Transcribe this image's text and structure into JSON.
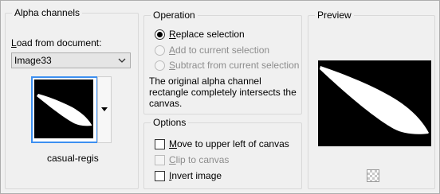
{
  "alpha_channels": {
    "title": "Alpha channels",
    "load_from_label_prefix": "L",
    "load_from_label_rest": "oad from document:",
    "document": "Image33",
    "channel_name": "casual-regis"
  },
  "operation": {
    "title": "Operation",
    "options": [
      {
        "key": "R",
        "rest": "eplace selection",
        "selected": true,
        "enabled": true
      },
      {
        "key": "A",
        "rest": "dd to current selection",
        "selected": false,
        "enabled": false
      },
      {
        "key": "S",
        "rest": "ubtract from current selection",
        "selected": false,
        "enabled": false
      }
    ],
    "description": "The original alpha channel rectangle completely intersects the canvas."
  },
  "options": {
    "title": "Options",
    "items": [
      {
        "key": "M",
        "rest": "ove to upper left of canvas",
        "checked": false,
        "enabled": true
      },
      {
        "key": "C",
        "rest": "lip to canvas",
        "checked": false,
        "enabled": false
      },
      {
        "key": "I",
        "rest": "nvert image",
        "checked": false,
        "enabled": true
      }
    ]
  },
  "preview": {
    "title": "Preview"
  },
  "colors": {
    "focus_border": "#3c8ff0",
    "disabled_text": "#8d8d8d"
  }
}
